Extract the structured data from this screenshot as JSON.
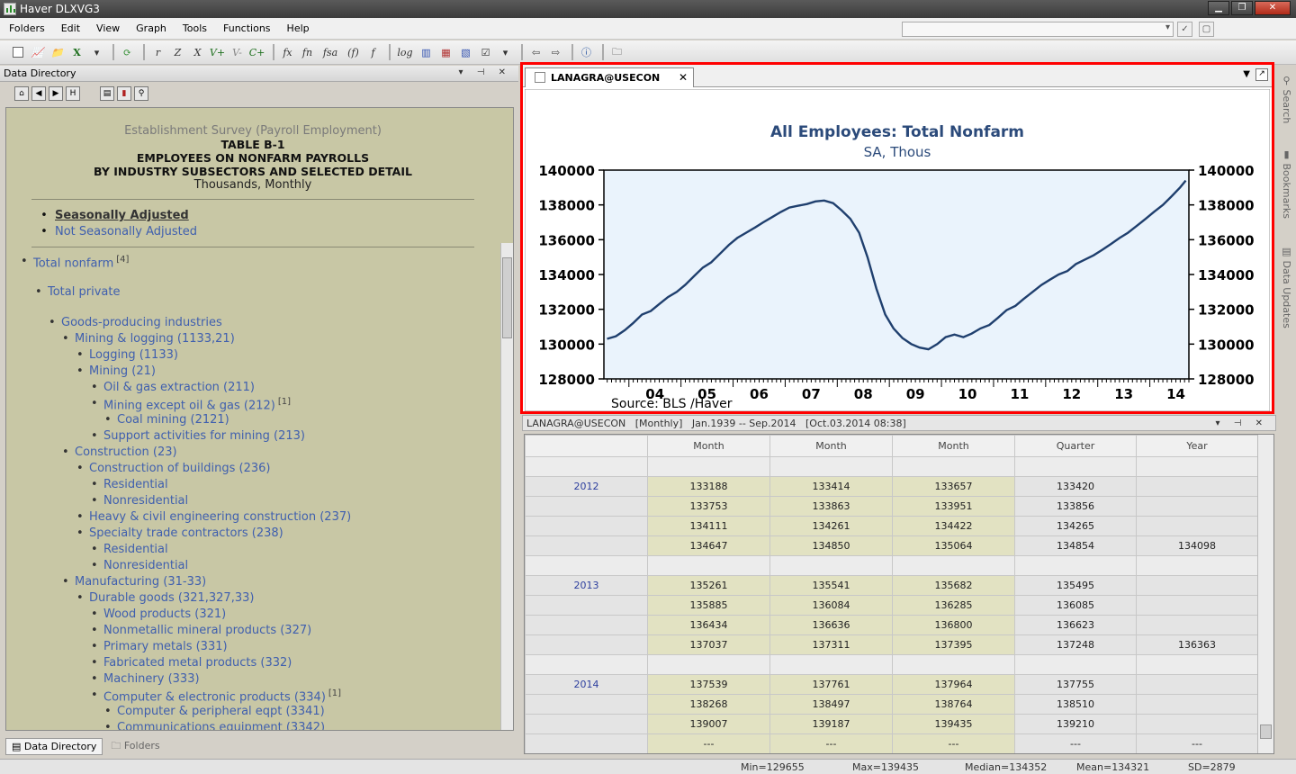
{
  "window": {
    "title": "Haver DLXVG3"
  },
  "menu": [
    "Folders",
    "Edit",
    "View",
    "Graph",
    "Tools",
    "Functions",
    "Help"
  ],
  "toolbar": {
    "letters": [
      "r",
      "Z",
      "X",
      "V+",
      "V-",
      "C+",
      "fx",
      "fn",
      "fsa",
      "(f)",
      "f",
      "log"
    ]
  },
  "left_panel": {
    "title": "Data Directory",
    "header": {
      "survey": "Establishment Survey (Payroll Employment)",
      "table": "TABLE B-1",
      "line1": "EMPLOYEES ON NONFARM PAYROLLS",
      "line2": "BY INDUSTRY SUBSECTORS AND SELECTED DETAIL",
      "units": "Thousands, Monthly"
    },
    "options": [
      "Seasonally Adjusted",
      "Not Seasonally Adjusted"
    ],
    "tree": [
      {
        "label": "Total nonfarm",
        "sup": "[4]",
        "level": 0
      },
      {
        "label": "Total private",
        "sup": "",
        "level": 1
      },
      {
        "label": "Goods-producing industries",
        "sup": "",
        "level": 2
      },
      {
        "label": "Mining & logging (1133,21)",
        "sup": "",
        "level": 3
      },
      {
        "label": "Logging (1133)",
        "sup": "",
        "level": 4
      },
      {
        "label": "Mining (21)",
        "sup": "",
        "level": 4
      },
      {
        "label": "Oil & gas extraction (211)",
        "sup": "",
        "level": 5
      },
      {
        "label": "Mining except oil & gas (212)",
        "sup": "[1]",
        "level": 5
      },
      {
        "label": "Coal mining (2121)",
        "sup": "",
        "level": 6
      },
      {
        "label": "Support activities for mining (213)",
        "sup": "",
        "level": 5
      },
      {
        "label": "Construction (23)",
        "sup": "",
        "level": 3
      },
      {
        "label": "Construction of buildings (236)",
        "sup": "",
        "level": 4
      },
      {
        "label": "Residential",
        "sup": "",
        "level": 5
      },
      {
        "label": "Nonresidential",
        "sup": "",
        "level": 5
      },
      {
        "label": "Heavy & civil engineering construction (237)",
        "sup": "",
        "level": 4
      },
      {
        "label": "Specialty trade contractors (238)",
        "sup": "",
        "level": 4
      },
      {
        "label": "Residential",
        "sup": "",
        "level": 5
      },
      {
        "label": "Nonresidential",
        "sup": "",
        "level": 5
      },
      {
        "label": "Manufacturing (31-33)",
        "sup": "",
        "level": 3
      },
      {
        "label": "Durable goods (321,327,33)",
        "sup": "",
        "level": 4
      },
      {
        "label": "Wood products (321)",
        "sup": "",
        "level": 5
      },
      {
        "label": "Nonmetallic mineral products (327)",
        "sup": "",
        "level": 5
      },
      {
        "label": "Primary metals (331)",
        "sup": "",
        "level": 5
      },
      {
        "label": "Fabricated metal products (332)",
        "sup": "",
        "level": 5
      },
      {
        "label": "Machinery (333)",
        "sup": "",
        "level": 5
      },
      {
        "label": "Computer & electronic products (334)",
        "sup": "[1]",
        "level": 5
      },
      {
        "label": "Computer & peripheral eqpt (3341)",
        "sup": "",
        "level": 6
      },
      {
        "label": "Communications equipment (3342)",
        "sup": "",
        "level": 6
      }
    ],
    "tabs": [
      "Data Directory",
      "Folders"
    ]
  },
  "graph": {
    "tab_label": "LANAGRA@USECON"
  },
  "chart_data": {
    "type": "line",
    "title": "All Employees: Total Nonfarm",
    "subtitle": "SA, Thous",
    "source": "Source:  BLS /Haver",
    "x_ticks": [
      "04",
      "05",
      "06",
      "07",
      "08",
      "09",
      "10",
      "11",
      "12",
      "13",
      "14"
    ],
    "y_ticks": [
      "140000",
      "138000",
      "136000",
      "134000",
      "132000",
      "130000",
      "128000"
    ],
    "ylim": [
      128000,
      140000
    ],
    "x_range": [
      2003.52,
      2014.75
    ],
    "line_color": "#1f3f6e",
    "plot_bg": "#eaf3fc",
    "title_color": "#2b4a7a",
    "x": [
      2003.58,
      2003.75,
      2003.92,
      2004.08,
      2004.25,
      2004.42,
      2004.58,
      2004.75,
      2004.92,
      2005.08,
      2005.25,
      2005.42,
      2005.58,
      2005.75,
      2005.92,
      2006.08,
      2006.25,
      2006.42,
      2006.58,
      2006.75,
      2006.92,
      2007.08,
      2007.25,
      2007.42,
      2007.58,
      2007.75,
      2007.92,
      2008.08,
      2008.25,
      2008.42,
      2008.58,
      2008.75,
      2008.92,
      2009.08,
      2009.25,
      2009.42,
      2009.58,
      2009.75,
      2009.92,
      2010.08,
      2010.25,
      2010.42,
      2010.58,
      2010.75,
      2010.92,
      2011.08,
      2011.25,
      2011.42,
      2011.58,
      2011.75,
      2011.92,
      2012.08,
      2012.25,
      2012.42,
      2012.58,
      2012.75,
      2012.92,
      2013.08,
      2013.25,
      2013.42,
      2013.58,
      2013.75,
      2013.92,
      2014.08,
      2014.25,
      2014.42,
      2014.58,
      2014.69
    ],
    "y": [
      130300,
      130450,
      130800,
      131200,
      131700,
      131900,
      132300,
      132700,
      133000,
      133400,
      133900,
      134400,
      134700,
      135200,
      135700,
      136100,
      136400,
      136700,
      137000,
      137300,
      137600,
      137850,
      137950,
      138050,
      138200,
      138250,
      138100,
      137700,
      137200,
      136400,
      135000,
      133200,
      131700,
      130900,
      130350,
      130000,
      129800,
      129700,
      130000,
      130400,
      130550,
      130400,
      130600,
      130900,
      131100,
      131500,
      131950,
      132200,
      132600,
      133000,
      133400,
      133700,
      134000,
      134200,
      134600,
      134850,
      135100,
      135400,
      135750,
      136100,
      136400,
      136800,
      137200,
      137600,
      138000,
      138500,
      139000,
      139400
    ]
  },
  "data_panel": {
    "series": "LANAGRA@USECON",
    "freq": "[Monthly]",
    "range": "Jan.1939 -- Sep.2014",
    "updated": "[Oct.03.2014 08:38]",
    "columns": [
      "",
      "Month",
      "Month",
      "Month",
      "Quarter",
      "Year"
    ],
    "rows": [
      {
        "year": "",
        "cells": [
          "",
          "",
          "",
          "",
          ""
        ],
        "blank": true
      },
      {
        "year": "2012",
        "cells": [
          "133188",
          "133414",
          "133657",
          "133420",
          ""
        ]
      },
      {
        "year": "",
        "cells": [
          "133753",
          "133863",
          "133951",
          "133856",
          ""
        ]
      },
      {
        "year": "",
        "cells": [
          "134111",
          "134261",
          "134422",
          "134265",
          ""
        ]
      },
      {
        "year": "",
        "cells": [
          "134647",
          "134850",
          "135064",
          "134854",
          "134098"
        ]
      },
      {
        "year": "",
        "cells": [
          "",
          "",
          "",
          "",
          ""
        ],
        "blank": true
      },
      {
        "year": "2013",
        "cells": [
          "135261",
          "135541",
          "135682",
          "135495",
          ""
        ]
      },
      {
        "year": "",
        "cells": [
          "135885",
          "136084",
          "136285",
          "136085",
          ""
        ]
      },
      {
        "year": "",
        "cells": [
          "136434",
          "136636",
          "136800",
          "136623",
          ""
        ]
      },
      {
        "year": "",
        "cells": [
          "137037",
          "137311",
          "137395",
          "137248",
          "136363"
        ]
      },
      {
        "year": "",
        "cells": [
          "",
          "",
          "",
          "",
          ""
        ],
        "blank": true
      },
      {
        "year": "2014",
        "cells": [
          "137539",
          "137761",
          "137964",
          "137755",
          ""
        ]
      },
      {
        "year": "",
        "cells": [
          "138268",
          "138497",
          "138764",
          "138510",
          ""
        ]
      },
      {
        "year": "",
        "cells": [
          "139007",
          "139187",
          "139435",
          "139210",
          ""
        ]
      },
      {
        "year": "",
        "cells": [
          "---",
          "---",
          "---",
          "---",
          "---"
        ]
      }
    ]
  },
  "right_sidebar": [
    "Search",
    "Bookmarks",
    "Data Updates"
  ],
  "status": {
    "min": "Min=129655",
    "max": "Max=139435",
    "median": "Median=134352",
    "mean": "Mean=134321",
    "sd": "SD=2879"
  }
}
